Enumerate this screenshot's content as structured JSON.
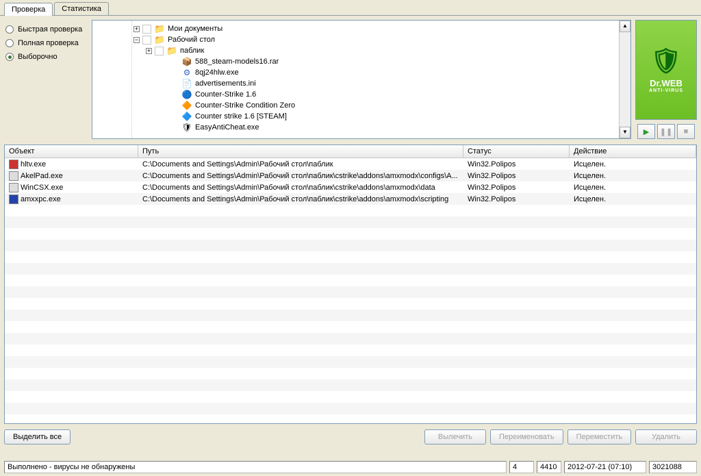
{
  "tabs": {
    "scan": "Проверка",
    "stats": "Статистика"
  },
  "radios": {
    "quick": "Быстрая проверка",
    "full": "Полная проверка",
    "custom": "Выборочно"
  },
  "tree": [
    {
      "indent": 0,
      "exp": "+",
      "chk": true,
      "icon": "📁",
      "cls": "folder",
      "label": "Мои документы"
    },
    {
      "indent": 0,
      "exp": "−",
      "chk": true,
      "icon": "📁",
      "cls": "folder",
      "label": "Рабочий стол"
    },
    {
      "indent": 1,
      "exp": "+",
      "chk": true,
      "icon": "📁",
      "cls": "folder",
      "label": "паблик"
    },
    {
      "indent": 2,
      "exp": "",
      "chk": false,
      "icon": "📦",
      "cls": "",
      "label": "588_steam-models16.rar"
    },
    {
      "indent": 2,
      "exp": "",
      "chk": false,
      "icon": "⚙",
      "cls": "app",
      "label": "8qj24hlw.exe"
    },
    {
      "indent": 2,
      "exp": "",
      "chk": false,
      "icon": "📄",
      "cls": "",
      "label": "advertisements.ini"
    },
    {
      "indent": 2,
      "exp": "",
      "chk": false,
      "icon": "🔵",
      "cls": "",
      "label": "Counter-Strike 1.6"
    },
    {
      "indent": 2,
      "exp": "",
      "chk": false,
      "icon": "🔶",
      "cls": "",
      "label": "Counter-Strike Condition Zero"
    },
    {
      "indent": 2,
      "exp": "",
      "chk": false,
      "icon": "🔷",
      "cls": "",
      "label": "Counter strike 1.6 [STEAM]"
    },
    {
      "indent": 2,
      "exp": "",
      "chk": false,
      "icon": "🛡",
      "cls": "",
      "label": "EasyAntiCheat.exe"
    }
  ],
  "logo": {
    "brand": "Dr.WEB",
    "sub": "ANTI-VIRUS"
  },
  "columns": {
    "object": "Объект",
    "path": "Путь",
    "status": "Статус",
    "action": "Действие"
  },
  "rows": [
    {
      "icon": "red",
      "obj": "hltv.exe",
      "path": "C:\\Documents and Settings\\Admin\\Рабочий стол\\паблик",
      "status": "Win32.Polipos",
      "action": "Исцелен."
    },
    {
      "icon": "gray",
      "obj": "AkelPad.exe",
      "path": "C:\\Documents and Settings\\Admin\\Рабочий стол\\паблик\\cstrike\\addons\\amxmodx\\configs\\A...",
      "status": "Win32.Polipos",
      "action": "Исцелен."
    },
    {
      "icon": "gray",
      "obj": "WinCSX.exe",
      "path": "C:\\Documents and Settings\\Admin\\Рабочий стол\\паблик\\cstrike\\addons\\amxmodx\\data",
      "status": "Win32.Polipos",
      "action": "Исцелен."
    },
    {
      "icon": "blue",
      "obj": "amxxpc.exe",
      "path": "C:\\Documents and Settings\\Admin\\Рабочий стол\\паблик\\cstrike\\addons\\amxmodx\\scripting",
      "status": "Win32.Polipos",
      "action": "Исцелен."
    }
  ],
  "buttons": {
    "select_all": "Выделить все",
    "cure": "Вылечить",
    "rename": "Переименовать",
    "move": "Переместить",
    "delete": "Удалить"
  },
  "status": {
    "text": "Выполнено - вирусы не обнаружены",
    "n1": "4",
    "n2": "4410",
    "date": "2012-07-21 (07:10)",
    "n3": "3021088"
  }
}
